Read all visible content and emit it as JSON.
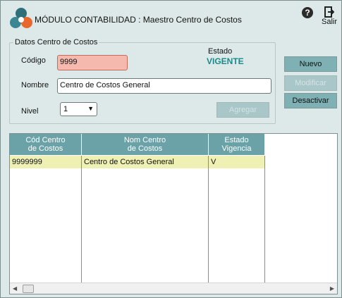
{
  "header": {
    "title": "MÓDULO CONTABILIDAD : Maestro Centro de Costos",
    "help_icon": "?",
    "exit_label": "Salir"
  },
  "form": {
    "group_title": "Datos Centro de Costos",
    "codigo_label": "Código",
    "codigo_value": "9999",
    "nombre_label": "Nombre",
    "nombre_value": "Centro de Costos General",
    "nivel_label": "Nivel",
    "nivel_value": "1",
    "estado_label": "Estado",
    "estado_value": "VIGENTE",
    "agregar_label": "Agregar"
  },
  "actions": {
    "nuevo_label": "Nuevo",
    "modificar_label": "Modificar",
    "desactivar_label": "Desactivar"
  },
  "grid": {
    "columns": [
      {
        "line1": "Cód Centro",
        "line2": "de Costos"
      },
      {
        "line1": "Nom Centro",
        "line2": "de Costos"
      },
      {
        "line1": "Estado",
        "line2": "Vigencia"
      }
    ],
    "rows": [
      [
        "9999999",
        "Centro de Costos General",
        "V"
      ]
    ]
  },
  "colors": {
    "header_teal": "#6aa2a8",
    "button_teal": "#7fb0b4",
    "selected_row": "#eef0b4",
    "codigo_highlight": "#f6b9ae",
    "estado_text": "#1a8a8a"
  }
}
